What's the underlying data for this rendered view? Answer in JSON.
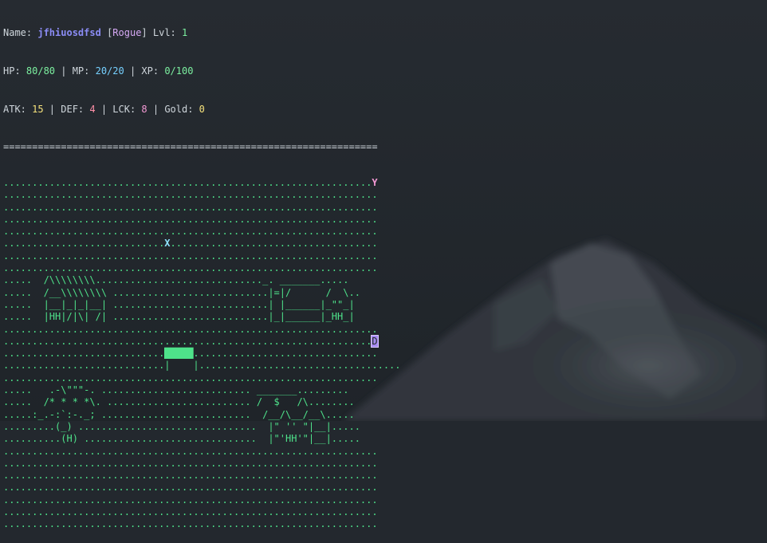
{
  "status": {
    "name_label": "Name: ",
    "name": "jfhiuosdfsd",
    "class_open": " [",
    "class": "Rogue",
    "class_close": "] ",
    "level_label": "Lvl: ",
    "level": "1",
    "hp_label": "HP: ",
    "hp": "80/80",
    "mp_label": " | MP: ",
    "mp": "20/20",
    "xp_label": " | XP: ",
    "xp": "0/100",
    "atk_label": "ATK: ",
    "atk": "15",
    "def_label": " | DEF: ",
    "def": "4",
    "lck_label": " | LCK: ",
    "lck": "8",
    "gold_label": " | Gold: ",
    "gold": "0"
  },
  "separator": "=================================================================",
  "map": {
    "rows": [
      [
        "................................................................",
        "Y",
        ""
      ],
      [
        ".................................................................",
        "",
        ""
      ],
      [
        ".................................................................",
        "",
        ""
      ],
      [
        ".................................................................",
        "",
        ""
      ],
      [
        ".................................................................",
        "",
        ""
      ],
      [
        "............................",
        "X",
        "...................................."
      ],
      [
        ".................................................................",
        "",
        ""
      ],
      [
        ".................................................................",
        "",
        ""
      ],
      [
        ".....  /\\\\\\\\\\\\\\\\............................._. _______.....",
        "",
        ""
      ],
      [
        ".....  /__\\\\\\\\\\\\\\\\ ...........................|=|/      /  \\..",
        "",
        ""
      ],
      [
        ".....  |__|_|_|__| ...........................| |______|_\"\"_|",
        "",
        ""
      ],
      [
        ".....  |HH|/|\\| /| ...........................|_|______|_HH_|",
        "",
        ""
      ],
      [
        ".................................................................",
        "",
        ""
      ],
      [
        "................................................................",
        "D",
        ""
      ],
      [
        "............................",
        "█████",
        "................................"
      ],
      [
        "............................|    |...................................",
        "",
        ""
      ],
      [
        ".................................................................",
        "",
        ""
      ],
      [
        ".....   .-\\\"\"\"-. .......................... _______.........",
        "",
        ""
      ],
      [
        ".....  /* * * *\\. ......................... /  $   /\\........",
        "",
        ""
      ],
      [
        ".....:_.-:`:-._; ..........................  /__/\\__/__\\.....",
        "",
        ""
      ],
      [
        ".........(_) ...............................  |\" '' \"|__|.....",
        "",
        ""
      ],
      [
        "..........(H) ..............................  |\"'HH'\"|__|.....",
        "",
        ""
      ],
      [
        ".................................................................",
        "",
        ""
      ],
      [
        ".................................................................",
        "",
        ""
      ],
      [
        ".................................................................",
        "",
        ""
      ],
      [
        ".................................................................",
        "",
        ""
      ],
      [
        ".................................................................",
        "",
        ""
      ],
      [
        ".................................................................",
        "",
        ""
      ],
      [
        ".................................................................",
        "",
        ""
      ]
    ]
  },
  "colors": {
    "background": "#23282e",
    "map_text": "#4ee28a",
    "name": "#8b8cf5",
    "class": "#d7a9f5",
    "hp": "#7cf0a0",
    "mp": "#76d0ff",
    "atk": "#f6e27c",
    "def": "#ff8fa8",
    "lck": "#f59ad6",
    "gold": "#f6e27c",
    "marker_x": "#8fe3ff",
    "marker_y": "#f59ad6",
    "marker_d": "#a78af2",
    "player": "#5ef59a"
  }
}
